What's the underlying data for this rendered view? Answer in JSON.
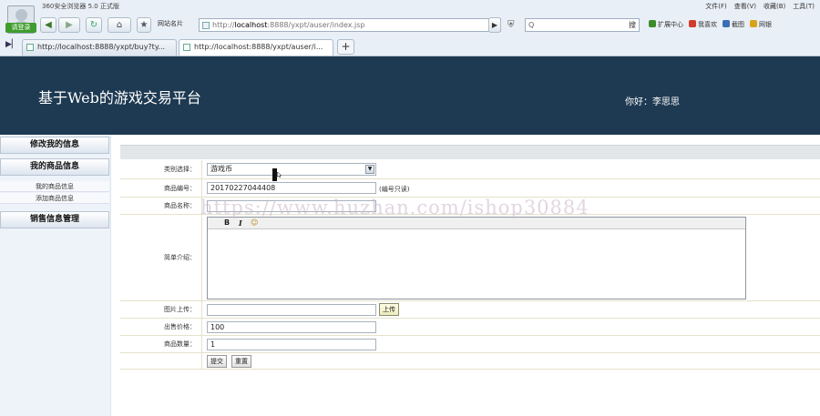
{
  "browser": {
    "window_title": "360安全浏览器 5.0 正式版",
    "login_label": "请登录",
    "top_menu": [
      "文件(F)",
      "查看(V)",
      "收藏(B)",
      "工具(T)"
    ],
    "site_name_label": "网站名片",
    "url": {
      "prefix": "http://",
      "host": "localhost",
      "rest": ":8888/yxpt/auser/index.jsp"
    },
    "search_placeholder": "Q",
    "search_button": "搜",
    "tools": [
      {
        "label": "扩展中心",
        "color": "#3c8c2c"
      },
      {
        "label": "我喜欢",
        "color": "#d23b2b"
      },
      {
        "label": "截图",
        "color": "#3a6fb5"
      },
      {
        "label": "网银",
        "color": "#d8a21a"
      }
    ],
    "tabs": [
      {
        "label": "http://localhost:8888/yxpt/buy?ty...",
        "active": false
      },
      {
        "label": "http://localhost:8888/yxpt/auser/i...",
        "active": true
      }
    ],
    "new_tab": "+"
  },
  "header": {
    "title": "基于Web的游戏交易平台",
    "greeting": "你好：李思思"
  },
  "sidebar": {
    "groups": [
      {
        "title": "修改我的信息",
        "items": []
      },
      {
        "title": "我的商品信息",
        "items": [
          "我的商品信息",
          "添加商品信息"
        ]
      },
      {
        "title": "销售信息管理",
        "items": []
      }
    ]
  },
  "form": {
    "category_label": "类别选择：",
    "category_value": "游戏币",
    "code_label": "商品编号：",
    "code_value": "20170227044408",
    "code_note": "(编号只读)",
    "name_label": "商品名称：",
    "name_value": "",
    "desc_label": "简单介绍：",
    "editor_tools": [
      "B",
      "I",
      "☺"
    ],
    "image_label": "图片上传：",
    "upload_button": "上传",
    "price_label": "出售价格：",
    "price_value": "100",
    "qty_label": "商品数量：",
    "qty_value": "1",
    "submit_button": "提交",
    "reset_button": "重置"
  },
  "watermark": "https://www.huzhan.com/ishop30884"
}
